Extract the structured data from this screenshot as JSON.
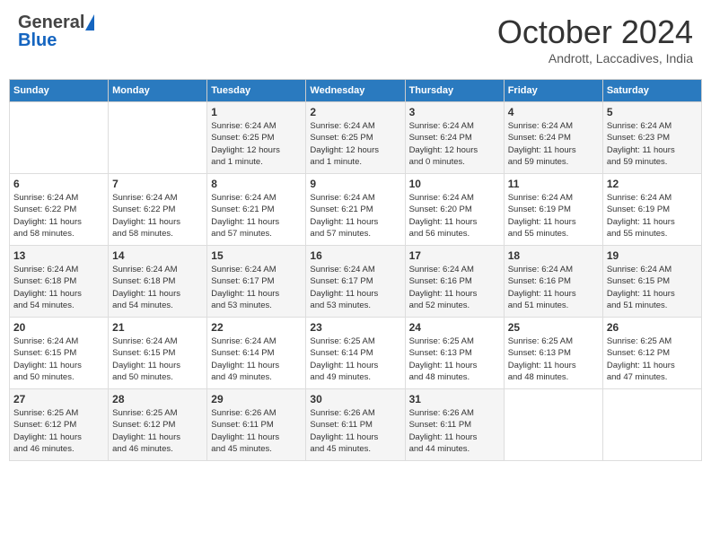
{
  "header": {
    "logo_general": "General",
    "logo_blue": "Blue",
    "month_title": "October 2024",
    "subtitle": "Andrott, Laccadives, India"
  },
  "days_of_week": [
    "Sunday",
    "Monday",
    "Tuesday",
    "Wednesday",
    "Thursday",
    "Friday",
    "Saturday"
  ],
  "weeks": [
    [
      {
        "day": "",
        "info": ""
      },
      {
        "day": "",
        "info": ""
      },
      {
        "day": "1",
        "info": "Sunrise: 6:24 AM\nSunset: 6:25 PM\nDaylight: 12 hours\nand 1 minute."
      },
      {
        "day": "2",
        "info": "Sunrise: 6:24 AM\nSunset: 6:25 PM\nDaylight: 12 hours\nand 1 minute."
      },
      {
        "day": "3",
        "info": "Sunrise: 6:24 AM\nSunset: 6:24 PM\nDaylight: 12 hours\nand 0 minutes."
      },
      {
        "day": "4",
        "info": "Sunrise: 6:24 AM\nSunset: 6:24 PM\nDaylight: 11 hours\nand 59 minutes."
      },
      {
        "day": "5",
        "info": "Sunrise: 6:24 AM\nSunset: 6:23 PM\nDaylight: 11 hours\nand 59 minutes."
      }
    ],
    [
      {
        "day": "6",
        "info": "Sunrise: 6:24 AM\nSunset: 6:22 PM\nDaylight: 11 hours\nand 58 minutes."
      },
      {
        "day": "7",
        "info": "Sunrise: 6:24 AM\nSunset: 6:22 PM\nDaylight: 11 hours\nand 58 minutes."
      },
      {
        "day": "8",
        "info": "Sunrise: 6:24 AM\nSunset: 6:21 PM\nDaylight: 11 hours\nand 57 minutes."
      },
      {
        "day": "9",
        "info": "Sunrise: 6:24 AM\nSunset: 6:21 PM\nDaylight: 11 hours\nand 57 minutes."
      },
      {
        "day": "10",
        "info": "Sunrise: 6:24 AM\nSunset: 6:20 PM\nDaylight: 11 hours\nand 56 minutes."
      },
      {
        "day": "11",
        "info": "Sunrise: 6:24 AM\nSunset: 6:19 PM\nDaylight: 11 hours\nand 55 minutes."
      },
      {
        "day": "12",
        "info": "Sunrise: 6:24 AM\nSunset: 6:19 PM\nDaylight: 11 hours\nand 55 minutes."
      }
    ],
    [
      {
        "day": "13",
        "info": "Sunrise: 6:24 AM\nSunset: 6:18 PM\nDaylight: 11 hours\nand 54 minutes."
      },
      {
        "day": "14",
        "info": "Sunrise: 6:24 AM\nSunset: 6:18 PM\nDaylight: 11 hours\nand 54 minutes."
      },
      {
        "day": "15",
        "info": "Sunrise: 6:24 AM\nSunset: 6:17 PM\nDaylight: 11 hours\nand 53 minutes."
      },
      {
        "day": "16",
        "info": "Sunrise: 6:24 AM\nSunset: 6:17 PM\nDaylight: 11 hours\nand 53 minutes."
      },
      {
        "day": "17",
        "info": "Sunrise: 6:24 AM\nSunset: 6:16 PM\nDaylight: 11 hours\nand 52 minutes."
      },
      {
        "day": "18",
        "info": "Sunrise: 6:24 AM\nSunset: 6:16 PM\nDaylight: 11 hours\nand 51 minutes."
      },
      {
        "day": "19",
        "info": "Sunrise: 6:24 AM\nSunset: 6:15 PM\nDaylight: 11 hours\nand 51 minutes."
      }
    ],
    [
      {
        "day": "20",
        "info": "Sunrise: 6:24 AM\nSunset: 6:15 PM\nDaylight: 11 hours\nand 50 minutes."
      },
      {
        "day": "21",
        "info": "Sunrise: 6:24 AM\nSunset: 6:15 PM\nDaylight: 11 hours\nand 50 minutes."
      },
      {
        "day": "22",
        "info": "Sunrise: 6:24 AM\nSunset: 6:14 PM\nDaylight: 11 hours\nand 49 minutes."
      },
      {
        "day": "23",
        "info": "Sunrise: 6:25 AM\nSunset: 6:14 PM\nDaylight: 11 hours\nand 49 minutes."
      },
      {
        "day": "24",
        "info": "Sunrise: 6:25 AM\nSunset: 6:13 PM\nDaylight: 11 hours\nand 48 minutes."
      },
      {
        "day": "25",
        "info": "Sunrise: 6:25 AM\nSunset: 6:13 PM\nDaylight: 11 hours\nand 48 minutes."
      },
      {
        "day": "26",
        "info": "Sunrise: 6:25 AM\nSunset: 6:12 PM\nDaylight: 11 hours\nand 47 minutes."
      }
    ],
    [
      {
        "day": "27",
        "info": "Sunrise: 6:25 AM\nSunset: 6:12 PM\nDaylight: 11 hours\nand 46 minutes."
      },
      {
        "day": "28",
        "info": "Sunrise: 6:25 AM\nSunset: 6:12 PM\nDaylight: 11 hours\nand 46 minutes."
      },
      {
        "day": "29",
        "info": "Sunrise: 6:26 AM\nSunset: 6:11 PM\nDaylight: 11 hours\nand 45 minutes."
      },
      {
        "day": "30",
        "info": "Sunrise: 6:26 AM\nSunset: 6:11 PM\nDaylight: 11 hours\nand 45 minutes."
      },
      {
        "day": "31",
        "info": "Sunrise: 6:26 AM\nSunset: 6:11 PM\nDaylight: 11 hours\nand 44 minutes."
      },
      {
        "day": "",
        "info": ""
      },
      {
        "day": "",
        "info": ""
      }
    ]
  ]
}
